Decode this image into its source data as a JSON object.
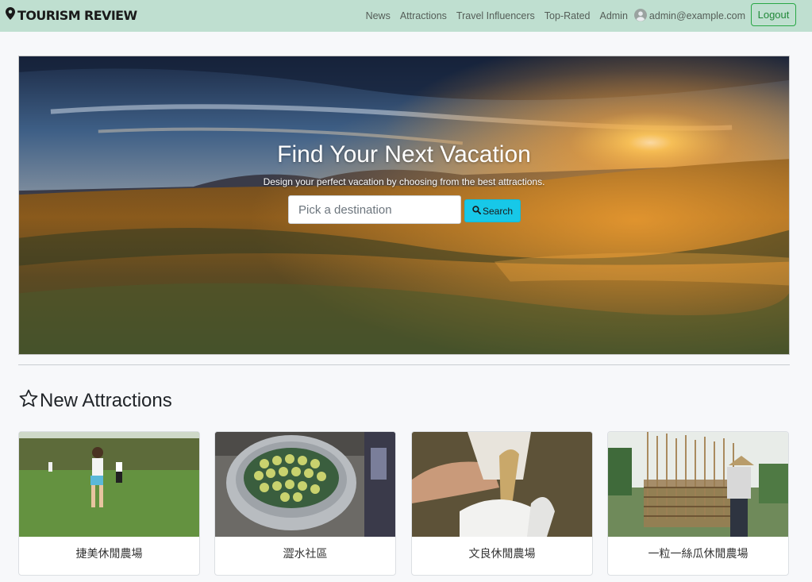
{
  "brand": {
    "name": "TOURISM REVIEW",
    "icon": "map-marker-icon"
  },
  "nav": {
    "links": [
      "News",
      "Attractions",
      "Travel Influencers",
      "Top-Rated",
      "Admin"
    ],
    "user_email": "admin@example.com",
    "user_icon": "user-avatar-icon",
    "logout_label": "Logout"
  },
  "hero": {
    "title": "Find Your Next Vacation",
    "subtitle": "Design your perfect vacation by choosing from the best attractions.",
    "search_placeholder": "Pick a destination",
    "search_value": "",
    "search_button_label": "Search",
    "search_icon": "search-icon"
  },
  "section": {
    "title": "New Attractions",
    "icon": "star-outline-icon"
  },
  "attractions": [
    {
      "name": "捷美休閒農場"
    },
    {
      "name": "澀水社區"
    },
    {
      "name": "文良休閒農場"
    },
    {
      "name": "一粒一絲瓜休閒農場"
    }
  ],
  "colors": {
    "navbar_bg": "#bfdfd0",
    "search_button": "#17c8e8",
    "logout_border": "#28a745",
    "page_bg": "#f7f8fa"
  }
}
